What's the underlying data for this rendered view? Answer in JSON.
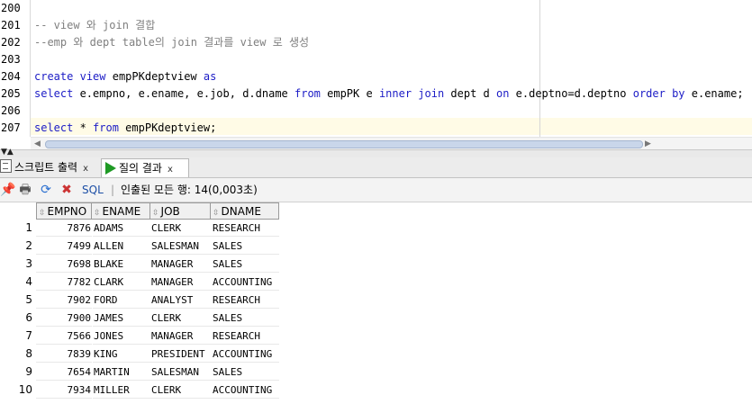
{
  "editor": {
    "lines": [
      {
        "no": "200",
        "parts": []
      },
      {
        "no": "201",
        "parts": [
          {
            "t": "-- view 와 join 결합",
            "c": "cmt"
          }
        ]
      },
      {
        "no": "202",
        "parts": [
          {
            "t": "--emp 와 dept table의 join 결과를 view 로 생성",
            "c": "cmt"
          }
        ]
      },
      {
        "no": "203",
        "parts": []
      },
      {
        "no": "204",
        "parts": [
          {
            "t": "create",
            "c": "kw"
          },
          {
            "t": " ",
            "c": ""
          },
          {
            "t": "view",
            "c": "kw"
          },
          {
            "t": " empPKdeptview ",
            "c": ""
          },
          {
            "t": "as",
            "c": "kw"
          }
        ]
      },
      {
        "no": "205",
        "parts": [
          {
            "t": "select",
            "c": "kw"
          },
          {
            "t": " e.empno, e.ename, e.job, d.dname ",
            "c": ""
          },
          {
            "t": "from",
            "c": "kw"
          },
          {
            "t": " empPK e ",
            "c": ""
          },
          {
            "t": "inner join",
            "c": "kw"
          },
          {
            "t": " dept d ",
            "c": ""
          },
          {
            "t": "on",
            "c": "kw"
          },
          {
            "t": " e.deptno=d.deptno ",
            "c": ""
          },
          {
            "t": "order by",
            "c": "kw"
          },
          {
            "t": " e.ename;",
            "c": ""
          }
        ]
      },
      {
        "no": "206",
        "parts": []
      },
      {
        "no": "207",
        "parts": [
          {
            "t": "select",
            "c": "kw"
          },
          {
            "t": " * ",
            "c": ""
          },
          {
            "t": "from",
            "c": "kw"
          },
          {
            "t": " empPKdeptview;",
            "c": ""
          }
        ]
      }
    ]
  },
  "tabs": {
    "script_output": "스크립트 출력",
    "query_result": "질의 결과",
    "close": "x"
  },
  "toolbar": {
    "sql_label": "SQL",
    "separator": "|",
    "status": "인출된 모든 행: 14(0,003초)"
  },
  "grid": {
    "sort_glyph": "⇳",
    "columns": [
      "EMPNO",
      "ENAME",
      "JOB",
      "DNAME"
    ],
    "rows": [
      [
        "1",
        "7876",
        "ADAMS",
        "CLERK",
        "RESEARCH"
      ],
      [
        "2",
        "7499",
        "ALLEN",
        "SALESMAN",
        "SALES"
      ],
      [
        "3",
        "7698",
        "BLAKE",
        "MANAGER",
        "SALES"
      ],
      [
        "4",
        "7782",
        "CLARK",
        "MANAGER",
        "ACCOUNTING"
      ],
      [
        "5",
        "7902",
        "FORD",
        "ANALYST",
        "RESEARCH"
      ],
      [
        "6",
        "7900",
        "JAMES",
        "CLERK",
        "SALES"
      ],
      [
        "7",
        "7566",
        "JONES",
        "MANAGER",
        "RESEARCH"
      ],
      [
        "8",
        "7839",
        "KING",
        "PRESIDENT",
        "ACCOUNTING"
      ],
      [
        "9",
        "7654",
        "MARTIN",
        "SALESMAN",
        "SALES"
      ],
      [
        "10",
        "7934",
        "MILLER",
        "CLERK",
        "ACCOUNTING"
      ]
    ]
  }
}
